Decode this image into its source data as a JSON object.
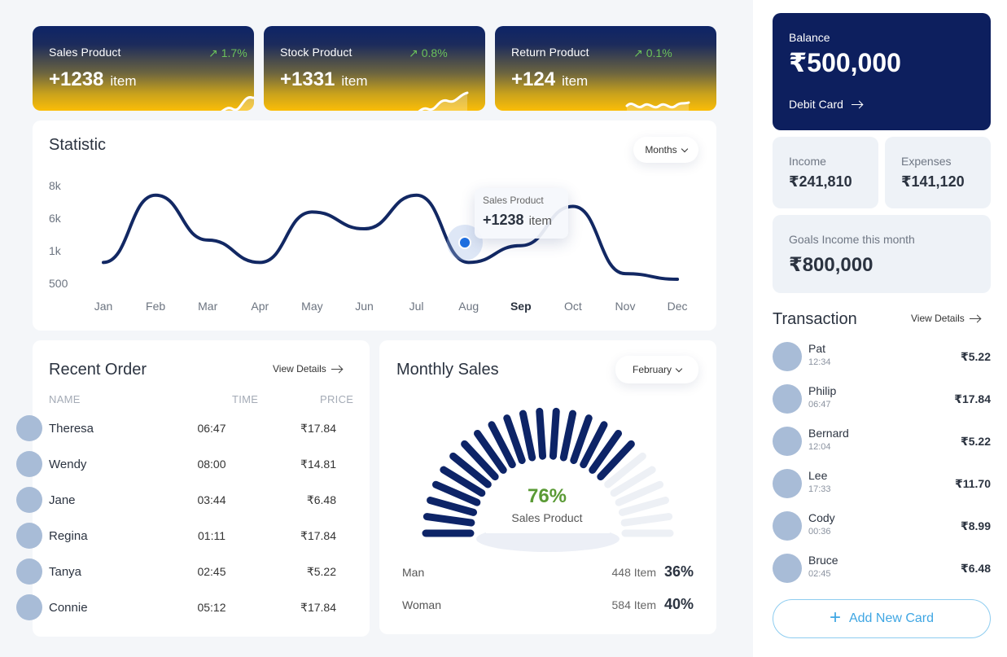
{
  "stat_cards": [
    {
      "label": "Sales Product",
      "value": "+1238",
      "unit": "item",
      "growth": "1.7%"
    },
    {
      "label": "Stock Product",
      "value": "+1331",
      "unit": "item",
      "growth": "0.8%"
    },
    {
      "label": "Return Product",
      "value": "+124",
      "unit": "item",
      "growth": "0.1%"
    }
  ],
  "statistic": {
    "title": "Statistic",
    "period_select": "Months",
    "tooltip": {
      "label": "Sales Product",
      "value": "+1238",
      "unit": "item"
    }
  },
  "chart_data": {
    "type": "line",
    "title": "Statistic",
    "categories": [
      "Jan",
      "Feb",
      "Mar",
      "Apr",
      "May",
      "Jun",
      "Jul",
      "Aug",
      "Sep",
      "Oct",
      "Nov",
      "Dec"
    ],
    "y_tick_labels": [
      "8k",
      "6k",
      "1k",
      "500"
    ],
    "series": [
      {
        "values": [
          1000,
          7000,
          3000,
          1000,
          5500,
          4000,
          7000,
          1000,
          2500,
          6000,
          0,
          -500
        ]
      }
    ],
    "highlight": {
      "category": "Aug",
      "label": "Sales Product",
      "value": "+1238"
    },
    "grid": false,
    "legend": "none"
  },
  "recent_order": {
    "title": "Recent Order",
    "view_details": "View Details",
    "columns": {
      "name": "NAME",
      "time": "TIME",
      "price": "PRICE"
    },
    "rows": [
      {
        "name": "Theresa",
        "time": "06:47",
        "price": "₹17.84"
      },
      {
        "name": "Wendy",
        "time": "08:00",
        "price": "₹14.81"
      },
      {
        "name": "Jane",
        "time": "03:44",
        "price": "₹6.48"
      },
      {
        "name": "Regina",
        "time": "01:11",
        "price": "₹17.84"
      },
      {
        "name": "Tanya",
        "time": "02:45",
        "price": "₹5.22"
      },
      {
        "name": "Connie",
        "time": "05:12",
        "price": "₹17.84"
      }
    ]
  },
  "monthly_sales": {
    "title": "Monthly Sales",
    "month_select": "February",
    "gauge_percent": 76,
    "percent_label": "76%",
    "gauge_caption": "Sales Product",
    "breakdown": [
      {
        "name": "Man",
        "items": "448 Item",
        "percent": "36%"
      },
      {
        "name": "Woman",
        "items": "584 Item",
        "percent": "40%"
      }
    ]
  },
  "balance": {
    "label": "Balance",
    "value": "₹500,000",
    "link": "Debit Card"
  },
  "income": {
    "label": "Income",
    "value": "₹241,810"
  },
  "expenses": {
    "label": "Expenses",
    "value": "₹141,120"
  },
  "goals": {
    "label": "Goals Income this month",
    "value": "₹800,000"
  },
  "transactions": {
    "title": "Transaction",
    "view_details": "View Details",
    "items": [
      {
        "name": "Pat",
        "time": "12:34",
        "amount": "₹5.22"
      },
      {
        "name": "Philip",
        "time": "06:47",
        "amount": "₹17.84"
      },
      {
        "name": "Bernard",
        "time": "12:04",
        "amount": "₹5.22"
      },
      {
        "name": "Lee",
        "time": "17:33",
        "amount": "₹11.70"
      },
      {
        "name": "Cody",
        "time": "00:36",
        "amount": "₹8.99"
      },
      {
        "name": "Bruce",
        "time": "02:45",
        "amount": "₹6.48"
      }
    ]
  },
  "add_card_label": "Add New Card",
  "colors": {
    "navy": "#0d1f5e",
    "gold": "#fbbd08",
    "growth_green": "#6cc25a",
    "percent_green": "#5a9a35",
    "button_blue": "#3fa6e3"
  }
}
